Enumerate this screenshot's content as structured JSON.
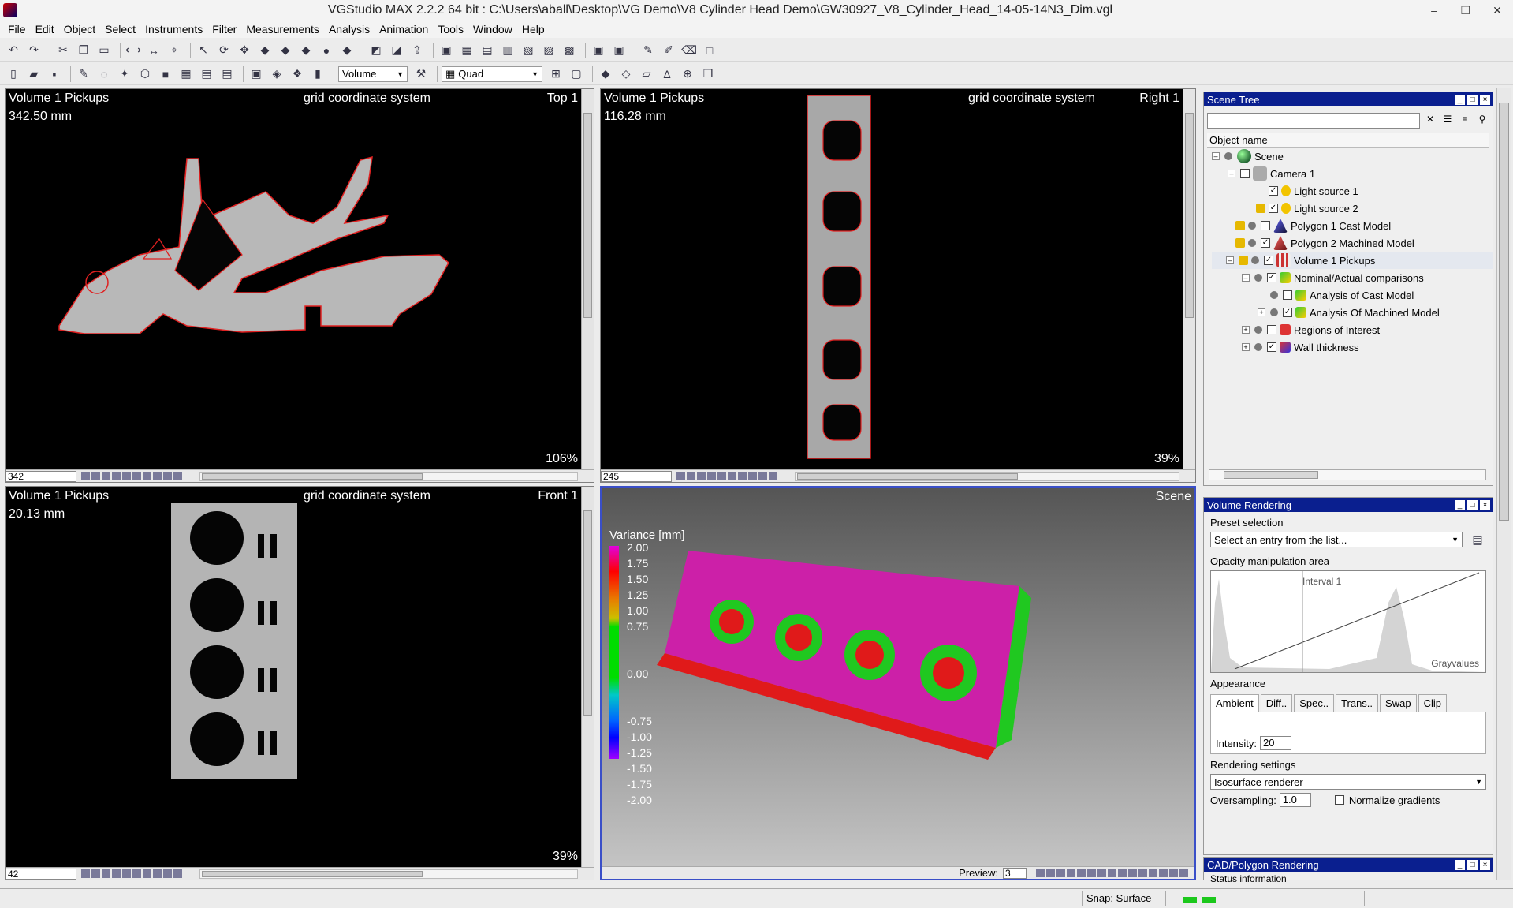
{
  "window": {
    "title": "VGStudio MAX 2.2.2 64 bit :  C:\\Users\\aball\\Desktop\\VG Demo\\V8 Cylinder Head Demo\\GW30927_V8_Cylinder_Head_14-05-14N3_Dim.vgl",
    "minimize": "–",
    "maximize": "❐",
    "close": "✕"
  },
  "menu": [
    "File",
    "Edit",
    "Object",
    "Select",
    "Instruments",
    "Filter",
    "Measurements",
    "Analysis",
    "Animation",
    "Tools",
    "Window",
    "Help"
  ],
  "toolbar2": {
    "volume_select": "Volume",
    "layout_select": "Quad"
  },
  "viewports": {
    "top": {
      "name": "Volume 1 Pickups",
      "distance": "342.50 mm",
      "coord": "grid coordinate system",
      "orientation": "Top 1",
      "zoom": "106%",
      "slice": "342"
    },
    "right": {
      "name": "Volume 1 Pickups",
      "distance": "116.28 mm",
      "coord": "grid coordinate system",
      "orientation": "Right 1",
      "zoom": "39%",
      "slice": "245"
    },
    "front": {
      "name": "Volume 1 Pickups",
      "distance": "20.13 mm",
      "coord": "grid coordinate system",
      "orientation": "Front 1",
      "zoom": "39%",
      "slice": "42"
    },
    "scene": {
      "name": "Scene",
      "preview_label": "Preview:",
      "preview_value": "3"
    }
  },
  "legend": {
    "title": "Variance [mm]",
    "ticks": [
      "2.00",
      "1.75",
      "1.50",
      "1.25",
      "1.00",
      "0.75",
      "0.00",
      "-0.75",
      "-1.00",
      "-1.25",
      "-1.50",
      "-1.75",
      "-2.00"
    ],
    "colors": {
      "high": "#e000e0",
      "zero": "#00dd00",
      "low": "#a000ff"
    }
  },
  "scene_tree": {
    "title": "Scene Tree",
    "column": "Object name",
    "items": [
      {
        "label": "Scene",
        "checked": false
      },
      {
        "label": "Camera 1",
        "checked": false
      },
      {
        "label": "Light source 1",
        "checked": true
      },
      {
        "label": "Light source 2",
        "checked": true
      },
      {
        "label": "Polygon 1 Cast Model",
        "checked": false
      },
      {
        "label": "Polygon 2 Machined Model",
        "checked": true
      },
      {
        "label": "Volume 1 Pickups",
        "checked": true
      },
      {
        "label": "Nominal/Actual comparisons",
        "checked": true
      },
      {
        "label": "Analysis of Cast Model",
        "checked": false
      },
      {
        "label": "Analysis Of Machined Model",
        "checked": true
      },
      {
        "label": "Regions of Interest",
        "checked": false
      },
      {
        "label": "Wall thickness",
        "checked": true
      }
    ]
  },
  "volume_rendering": {
    "title": "Volume Rendering",
    "preset_label": "Preset selection",
    "preset_value": "Select an entry from the list...",
    "opacity_label": "Opacity manipulation area",
    "interval_label": "Interval 1",
    "grayvalues_label": "Grayvalues",
    "appearance_label": "Appearance",
    "tabs": [
      "Ambient",
      "Diff..",
      "Spec..",
      "Trans..",
      "Swap",
      "Clip"
    ],
    "intensity_label": "Intensity:",
    "intensity_value": "20",
    "rendering_label": "Rendering settings",
    "renderer_value": "Isosurface renderer",
    "oversampling_label": "Oversampling:",
    "oversampling_value": "1.0",
    "normalize_label": "Normalize gradients"
  },
  "cad_rendering": {
    "title": "CAD/Polygon Rendering",
    "status_label": "Status information"
  },
  "statusbar": {
    "snap": "Snap: Surface"
  }
}
